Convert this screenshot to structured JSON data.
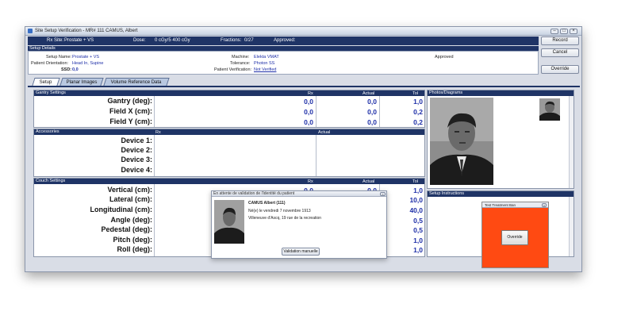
{
  "window": {
    "title": "Site Setup Verification - MR# 111   CAMUS, Albert"
  },
  "header": {
    "rx_site_label": "Rx Site:",
    "rx_site_value": "Prostate + VS",
    "dose_label": "Dose:",
    "dose_value": "0 cGy/5 400 cGy",
    "fractions_label": "Fractions:",
    "fractions_value": "0/27",
    "approved_label": "Approved:"
  },
  "setup_details": {
    "title": "Setup Details",
    "setup_name_label": "Setup Name:",
    "setup_name_value": "Prostate + VS",
    "orientation_label": "Patient Orientation:",
    "orientation_value": "Head In, Supine",
    "ssd_label": "SSD:",
    "ssd_value": "0,0",
    "machine_label": "Machine:",
    "machine_value": "Elekta VMAT",
    "tolerance_label": "Tolerance:",
    "tolerance_value": "Photon SS",
    "verification_label": "Patient Verification:",
    "verification_value": "Not Verified",
    "approved_label": "Approved"
  },
  "buttons": {
    "record": "Record",
    "cancel": "Cancel",
    "override": "Override"
  },
  "tabs": [
    "Setup",
    "Planar Images",
    "Volume Reference Data"
  ],
  "gantry": {
    "title": "Gantry Settings",
    "cols": [
      "Rx",
      "Actual",
      "Tol"
    ],
    "rows": [
      {
        "label": "Gantry (deg):",
        "rx": "0,0",
        "actual": "0,0",
        "tol": "1,0"
      },
      {
        "label": "Field X (cm):",
        "rx": "0,0",
        "actual": "0,0",
        "tol": "0,2"
      },
      {
        "label": "Field Y (cm):",
        "rx": "0,0",
        "actual": "0,0",
        "tol": "0,2"
      }
    ]
  },
  "accessories": {
    "title": "Accessories",
    "cols": [
      "Rx",
      "Actual"
    ],
    "rows": [
      "Device 1:",
      "Device 2:",
      "Device 3:",
      "Device 4:"
    ]
  },
  "couch": {
    "title": "Couch Settings",
    "cols": [
      "Rx",
      "Actual",
      "Tol"
    ],
    "rows": [
      {
        "label": "Vertical (cm):",
        "rx": "0,0",
        "actual": "0,0",
        "tol": "1,0"
      },
      {
        "label": "Lateral (cm):",
        "tol": "10,0"
      },
      {
        "label": "Longitudinal (cm):",
        "tol": "40,0"
      },
      {
        "label": "Angle (deg):",
        "tol": "0,5"
      },
      {
        "label": "Pedestal (deg):",
        "tol": "0,5"
      },
      {
        "label": "Pitch (deg):",
        "tol": "1,0"
      },
      {
        "label": "Roll (deg):",
        "tol": "1,0"
      }
    ]
  },
  "photos": {
    "title": "Photos/Diagrams"
  },
  "instructions": {
    "title": "Setup Instructions"
  },
  "popup": {
    "title": "En attente de validation de l'identité du patient",
    "name": "CAMUS Albert (111)",
    "born": "Né(e) le vendredi 7 novembre 1913",
    "address": "Villeneuve d'Ascq, 19 rue de la recreation",
    "button": "Validation manuelle"
  },
  "test_ban": {
    "title": "Test Treatment Ban",
    "button": "Override",
    "color": "#ff4a12"
  },
  "colors": {
    "header": "#1f3466",
    "value": "#1e2fa8"
  }
}
